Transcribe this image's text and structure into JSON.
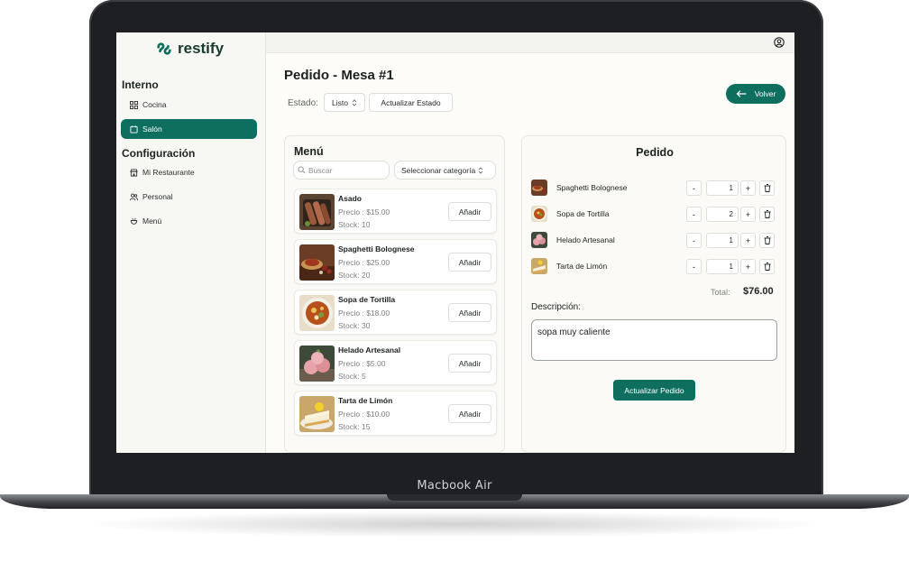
{
  "device": {
    "label": "Macbook Air"
  },
  "brand": {
    "name": "restify"
  },
  "sidebar": {
    "sections": [
      {
        "title": "Interno"
      },
      {
        "title": "Configuración"
      }
    ],
    "items": [
      {
        "label": "Cocina",
        "icon": "grid-icon"
      },
      {
        "label": "Salón",
        "icon": "table-icon",
        "active": true
      },
      {
        "label": "Mi Restaurante",
        "icon": "store-icon"
      },
      {
        "label": "Personal",
        "icon": "users-icon"
      },
      {
        "label": "Menú",
        "icon": "menu-icon"
      }
    ]
  },
  "topbar": {
    "icon": "user-circle-icon"
  },
  "header": {
    "title": "Pedido - Mesa #1",
    "status_label": "Estado:",
    "status_value": "Listo",
    "update_status_label": "Actualizar Estado",
    "back_label": "Volver"
  },
  "menu": {
    "title": "Menú",
    "search_placeholder": "Buscar",
    "category_placeholder": "Seleccionar categoría",
    "price_prefix": "Precio : ",
    "stock_prefix": "Stock: ",
    "add_label": "Añadir",
    "items": [
      {
        "name": "Asado",
        "price": "$15.00",
        "stock": "10"
      },
      {
        "name": "Spaghetti Bolognese",
        "price": "$25.00",
        "stock": "20"
      },
      {
        "name": "Sopa de Tortilla",
        "price": "$18.00",
        "stock": "30"
      },
      {
        "name": "Helado Artesanal",
        "price": "$5.00",
        "stock": "5"
      },
      {
        "name": "Tarta de Limón",
        "price": "$10.00",
        "stock": "15"
      }
    ]
  },
  "order": {
    "title": "Pedido",
    "items": [
      {
        "name": "Spaghetti Bolognese",
        "qty": "1"
      },
      {
        "name": "Sopa de Tortilla",
        "qty": "2"
      },
      {
        "name": "Helado Artesanal",
        "qty": "1"
      },
      {
        "name": "Tarta de Limón",
        "qty": "1"
      }
    ],
    "minus_label": "-",
    "plus_label": "+",
    "total_label": "Total:",
    "total_value": "$76.00",
    "description_label": "Descripción:",
    "description_value": "sopa muy caliente",
    "update_label": "Actualizar Pedido"
  },
  "colors": {
    "accent": "#0f6f5e",
    "background": "#fdfcf8",
    "sidebar": "#f7f7f4",
    "frame": "#1d1f22"
  }
}
